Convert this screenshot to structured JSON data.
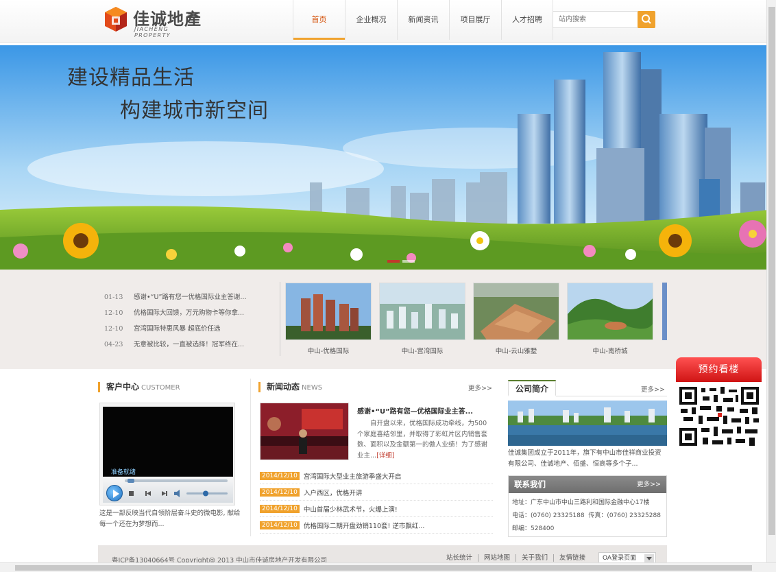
{
  "header": {
    "logo_cn": "佳诚地產",
    "logo_en": "JIACHENG PROPERTY",
    "nav": [
      {
        "label": "首页",
        "active": true
      },
      {
        "label": "企业概况",
        "active": false
      },
      {
        "label": "新闻资讯",
        "active": false
      },
      {
        "label": "项目展厅",
        "active": false
      },
      {
        "label": "人才招聘",
        "active": false
      }
    ],
    "search_placeholder": "站内搜索",
    "accent": "#f0a22d"
  },
  "banner": {
    "line1": "建设精品生活",
    "line2": "构建城市新空间",
    "slide_count": 2,
    "active_slide": 1
  },
  "news_mini": [
    {
      "date": "01-13",
      "title": "感谢•“U”路有您一优格国际业主答谢..."
    },
    {
      "date": "12-10",
      "title": "优格国际大回馈，万元购物卡等你拿..."
    },
    {
      "date": "12-10",
      "title": "宫湾国际特惠风暴 超底价任选"
    },
    {
      "date": "04-23",
      "title": "无意被比较，一直被选择！冠军终在..."
    }
  ],
  "projects": [
    {
      "caption": "中山-优格国际"
    },
    {
      "caption": "中山-宫湾国际"
    },
    {
      "caption": "中山-云山雅墅"
    },
    {
      "caption": "中山-南桥城"
    }
  ],
  "customer": {
    "title": "客户中心",
    "title_en": "CUSTOMER",
    "video_status": "准备就绪",
    "description": "这是一部反映当代自领阶层奋斗史的微电影, 献给每一个还在为梦想而..."
  },
  "news": {
    "title": "新闻动态",
    "title_en": "NEWS",
    "more": "更多>>",
    "feature_title": "感谢•“U”路有您—优格国际业主答...",
    "feature_body": "自开盘以来，优格国际成功牵线，为500个家庭喜结邻里，并取得了彩虹片区内销售套数、面积以及金额第一的傲人业绩！为了感谢业主...",
    "feature_detail": "[详细]",
    "items": [
      {
        "date": "2014/12/10",
        "title": "宫湾国际大型业主旅游季盛大开启"
      },
      {
        "date": "2014/12/10",
        "title": "入户西区，优格开讲"
      },
      {
        "date": "2014/12/10",
        "title": "中山首届少林武术节，火爆上演!"
      },
      {
        "date": "2014/12/10",
        "title": "优格国际二期开盘劲销110套! 逆市飘红..."
      }
    ]
  },
  "about": {
    "tab": "公司简介",
    "more": "更多>>",
    "text": "佳诚集团成立于2011年，旗下有中山市佳祥商业投资有限公司、佳诚地产、佰盛、恒高等多个子..."
  },
  "contact": {
    "title": "联系我们",
    "more": "更多>>",
    "address": "地址：广东中山市中山三路利和国际金融中心17楼",
    "phone": "电话：(0760) 23325188",
    "fax": "传真：(0760) 23325288",
    "zip": "邮编：528400"
  },
  "side": {
    "booking": "预约看楼"
  },
  "footer": {
    "copyright": "粤ICP备13040664号 Copyright@ 2013 中山市佳诚房地产开发有限公司",
    "links": [
      "站长统计",
      "网站地图",
      "关于我们",
      "友情链接"
    ],
    "select_value": "OA登录页面"
  }
}
